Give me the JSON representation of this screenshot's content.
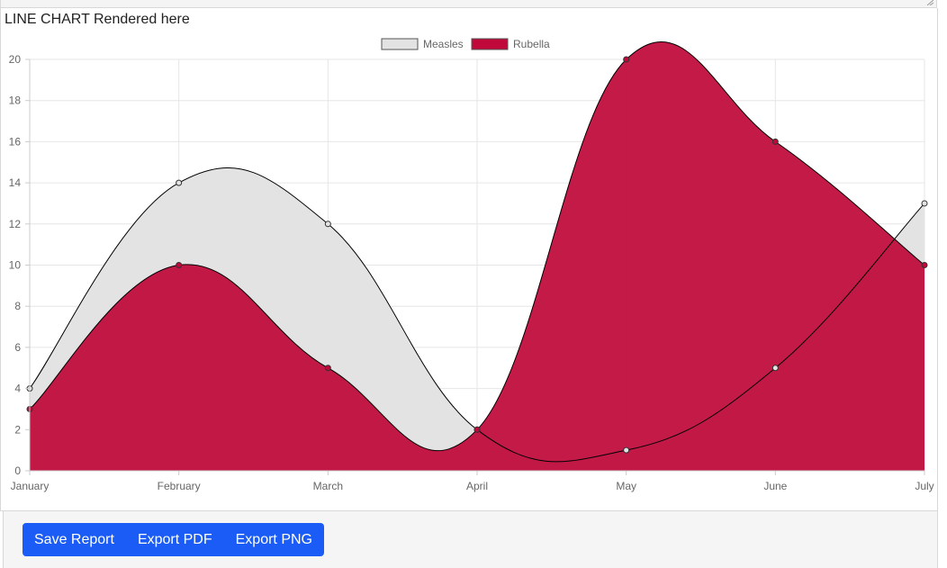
{
  "caption": "LINE CHART Rendered here",
  "footer": {
    "save_label": "Save Report",
    "export_pdf_label": "Export PDF",
    "export_png_label": "Export PNG"
  },
  "colors": {
    "measles_fill": "#e3e3e3",
    "rubella_fill": "#c0093a",
    "overlap_fill": "#a90f30",
    "line": "#000000",
    "button": "#1a5cf5"
  },
  "chart_data": {
    "type": "line",
    "categories": [
      "January",
      "February",
      "March",
      "April",
      "May",
      "June",
      "July"
    ],
    "series": [
      {
        "name": "Measles",
        "values": [
          4,
          14,
          12,
          2,
          1,
          5,
          13
        ],
        "color": "#e3e3e3"
      },
      {
        "name": "Rubella",
        "values": [
          3,
          10,
          5,
          2,
          20,
          16,
          10
        ],
        "color": "#c0093a"
      }
    ],
    "ylim": [
      0,
      20
    ],
    "yticks": [
      0,
      2,
      4,
      6,
      8,
      10,
      12,
      14,
      16,
      18,
      20
    ],
    "grid": true,
    "legend_position": "top-center",
    "fill": true,
    "smooth": true
  }
}
